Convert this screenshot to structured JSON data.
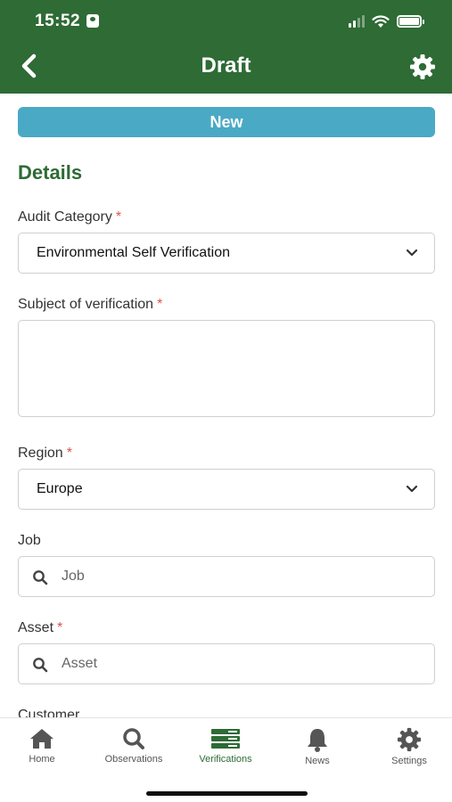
{
  "status_bar": {
    "time": "15:52"
  },
  "header": {
    "title": "Draft"
  },
  "status_pill": "New",
  "details": {
    "section_title": "Details",
    "audit_category": {
      "label": "Audit Category",
      "required_mark": "*",
      "value": "Environmental Self Verification"
    },
    "subject": {
      "label": "Subject of verification",
      "required_mark": "*",
      "value": ""
    },
    "region": {
      "label": "Region",
      "required_mark": "*",
      "value": "Europe"
    },
    "job": {
      "label": "Job",
      "placeholder": "Job"
    },
    "asset": {
      "label": "Asset",
      "required_mark": "*",
      "placeholder": "Asset"
    },
    "customer": {
      "label": "Customer"
    }
  },
  "tabs": [
    {
      "label": "Home",
      "icon": "home-icon"
    },
    {
      "label": "Observations",
      "icon": "search-icon"
    },
    {
      "label": "Verifications",
      "icon": "list-icon",
      "active": true
    },
    {
      "label": "News",
      "icon": "bell-icon"
    },
    {
      "label": "Settings",
      "icon": "gear-icon"
    }
  ],
  "colors": {
    "header": "#2e6b35",
    "accent_green": "#2e6b35",
    "status_pill": "#4aa9c4",
    "required": "#d9534f"
  }
}
